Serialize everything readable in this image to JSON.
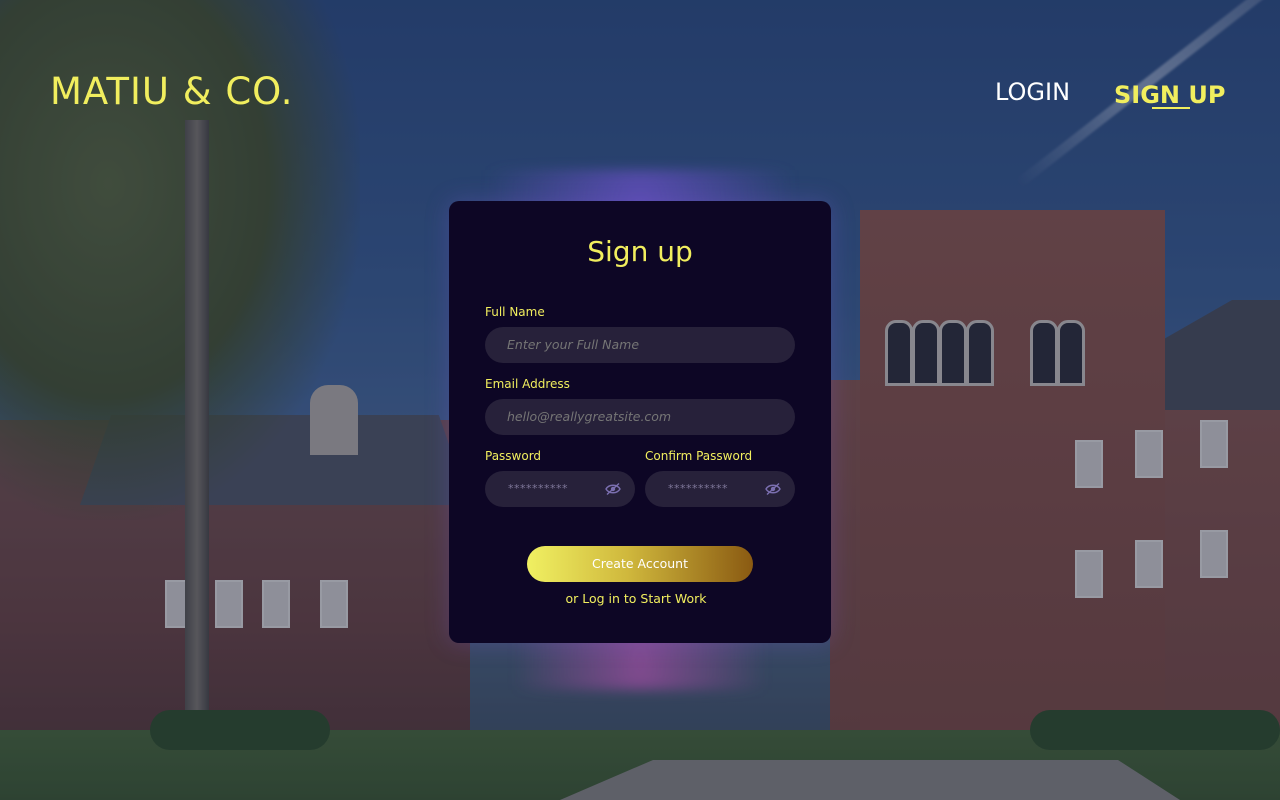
{
  "brand": {
    "name": "MATIU & CO."
  },
  "nav": {
    "login": "LOGIN",
    "signup": "SIGN UP"
  },
  "form": {
    "title": "Sign up",
    "full_name": {
      "label": "Full Name",
      "placeholder": "Enter your Full Name",
      "value": ""
    },
    "email": {
      "label": "Email Address",
      "placeholder": "hello@reallygreatsite.com",
      "value": ""
    },
    "password": {
      "label": "Password",
      "masked": "**********",
      "icon": "eye-slash-icon"
    },
    "confirm_password": {
      "label": "Confirm Password",
      "masked": "**********",
      "icon": "eye-slash-icon"
    },
    "submit": "Create Account",
    "alt_link": "or Log in to Start Work"
  },
  "colors": {
    "accent": "#f1ee5e",
    "card_bg": "#0d0625",
    "input_bg": "#27213a",
    "button_gradient_start": "#f0f062",
    "button_gradient_end": "#8a5a12"
  }
}
